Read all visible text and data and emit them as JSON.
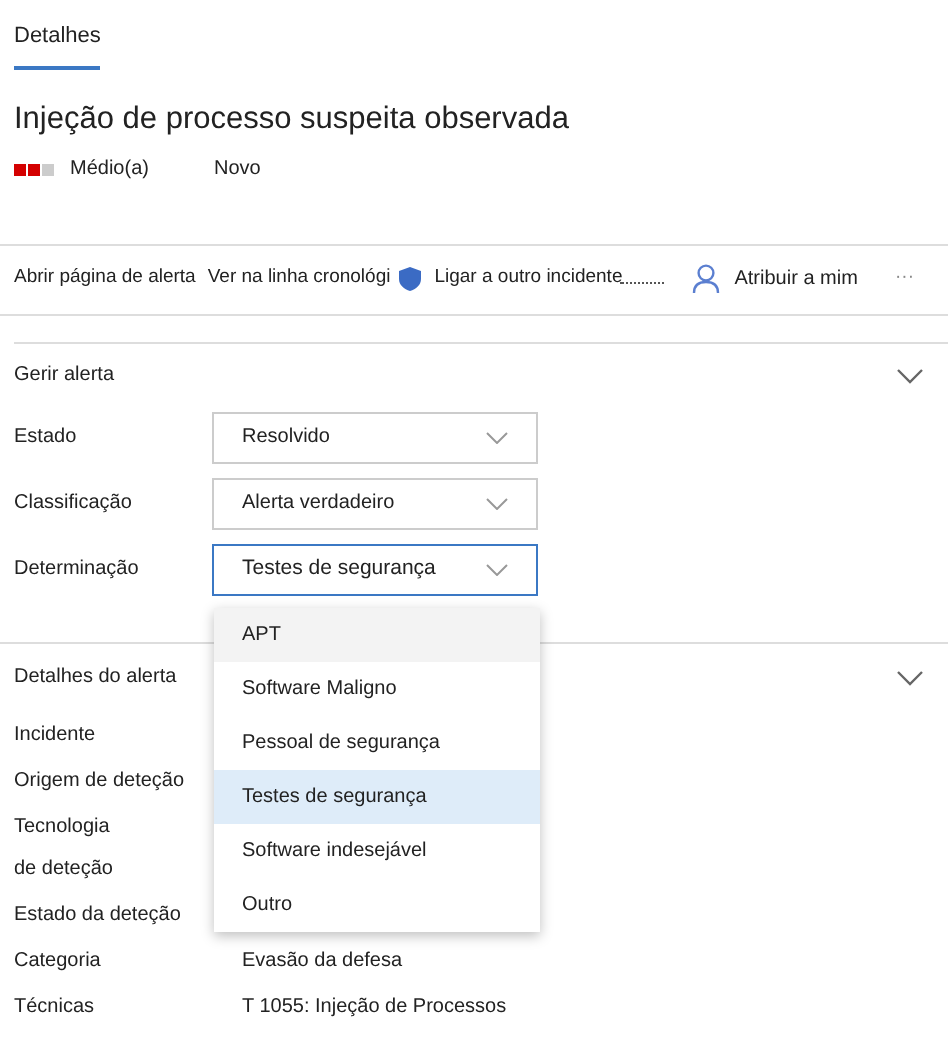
{
  "tabs": [
    {
      "label": "Detalhes",
      "selected": true
    }
  ],
  "alert": {
    "title": "Injeção de processo suspeita observada",
    "severity": {
      "label": "Médio(a)",
      "kind": "medium"
    },
    "status": "Novo"
  },
  "toolbar": [
    {
      "label": "Abrir página de alerta",
      "kind": "text"
    },
    {
      "label": "Ver na linha cronológi",
      "kind": "shield"
    },
    {
      "label": "Ligar a outro incidente",
      "kind": "dots"
    },
    {
      "label": "Atribuir a mim",
      "kind": "person"
    },
    {
      "label": "···",
      "kind": "more"
    }
  ],
  "manage": {
    "title": "Gerir alerta",
    "expanded": true,
    "fields": [
      {
        "label": "Estado",
        "value": "Resolvido",
        "open": false
      },
      {
        "label": "Classificação",
        "value": "Alerta verdadeiro",
        "open": false
      },
      {
        "label": "Determinação",
        "value": "Testes de segurança",
        "open": true
      }
    ],
    "options": [
      {
        "label": "APT",
        "selected": false,
        "highlighted": true
      },
      {
        "label": "Software Maligno",
        "selected": false,
        "highlighted": false
      },
      {
        "label": "Pessoal de segurança",
        "selected": false,
        "highlighted": false
      },
      {
        "label": "Testes de segurança",
        "selected": true,
        "highlighted": false
      },
      {
        "label": "Software indesejável",
        "selected": false,
        "highlighted": false
      },
      {
        "label": "Outro",
        "selected": false,
        "highlighted": false
      }
    ]
  },
  "details": {
    "title": "Detalhes do alerta",
    "expanded": true,
    "rows": [
      {
        "label": "Incidente"
      },
      {
        "label": "Origem de deteção"
      },
      {
        "label": "Tecnologia\nde deteção"
      },
      {
        "label": "Estado da deteção"
      },
      {
        "label": "Categoria",
        "value": "Evasão da defesa"
      },
      {
        "label": "Técnicas",
        "value": "T 1055: Injeção de Processos"
      }
    ]
  }
}
